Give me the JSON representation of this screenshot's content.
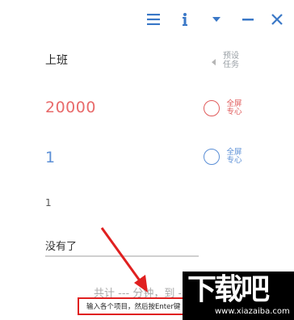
{
  "task": {
    "title": "上班",
    "preset_label": "预设任务"
  },
  "fields": {
    "red_value": "20000",
    "red_option_label": "全屏专心",
    "blue_value": "1",
    "blue_option_label": "全屏专心",
    "small_value": "1"
  },
  "input": {
    "value": "没有了"
  },
  "summary": {
    "text": "共计 --- 分钟，到 -"
  },
  "hint": {
    "text": "输入各个项目，然后按Enter键"
  },
  "watermark": {
    "main": "下载吧",
    "url": "www.xiazaiba.com"
  },
  "colors": {
    "accent": "#3a78c7",
    "red": "#e05b5b",
    "blue": "#5b8fd6",
    "annotation": "#e02020"
  },
  "icons": {
    "menu": "hamburger-menu-icon",
    "info": "info-icon",
    "dropdown": "caret-down-icon",
    "minimize": "minimize-icon",
    "close": "close-icon",
    "preset": "caret-left-icon"
  }
}
